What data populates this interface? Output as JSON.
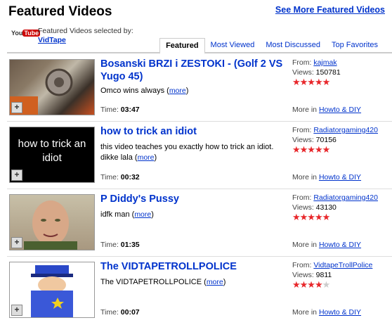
{
  "header": {
    "title": "Featured Videos",
    "see_more": "See More Featured Videos",
    "selected_by_label": "Featured Videos selected by:",
    "selected_by_user": "VidTape",
    "logo_you": "You",
    "logo_tube": "Tube"
  },
  "tabs": [
    {
      "label": "Featured",
      "active": true
    },
    {
      "label": "Most Viewed",
      "active": false
    },
    {
      "label": "Most Discussed",
      "active": false
    },
    {
      "label": "Top Favorites",
      "active": false
    }
  ],
  "videos": [
    {
      "title": "Bosanski BRZI i ZESTOKI - (Golf 2 VS Yugo 45)",
      "description": "Omco wins always",
      "more": "more",
      "time_label": "Time:",
      "time": "03:47",
      "from_label": "From:",
      "from": "kajmak",
      "views_label": "Views:",
      "views": "150781",
      "rating": 5,
      "more_in_label": "More in",
      "category": "Howto & DIY",
      "thumb_text": ""
    },
    {
      "title": "how to trick an idiot",
      "description": "this video teaches you exactly how to trick an idiot. dikke lala",
      "more": "more",
      "time_label": "Time:",
      "time": "00:32",
      "from_label": "From:",
      "from": "Radiatorgaming420",
      "views_label": "Views:",
      "views": "70156",
      "rating": 5,
      "more_in_label": "More in",
      "category": "Howto & DIY",
      "thumb_text": "how to trick an idiot"
    },
    {
      "title": "P Diddy's Pussy",
      "description": "idfk man",
      "more": "more",
      "time_label": "Time:",
      "time": "01:35",
      "from_label": "From:",
      "from": "Radiatorgaming420",
      "views_label": "Views:",
      "views": "43130",
      "rating": 5,
      "more_in_label": "More in",
      "category": "Howto & DIY",
      "thumb_text": ""
    },
    {
      "title": "The VIDTAPETROLLPOLICE",
      "description": "The VIDTAPETROLLPOLICE",
      "more": "more",
      "time_label": "Time:",
      "time": "00:07",
      "from_label": "From:",
      "from": "VidtapeTrollPolice",
      "views_label": "Views:",
      "views": "9811",
      "rating": 4,
      "more_in_label": "More in",
      "category": "Howto & DIY",
      "thumb_text": ""
    }
  ]
}
